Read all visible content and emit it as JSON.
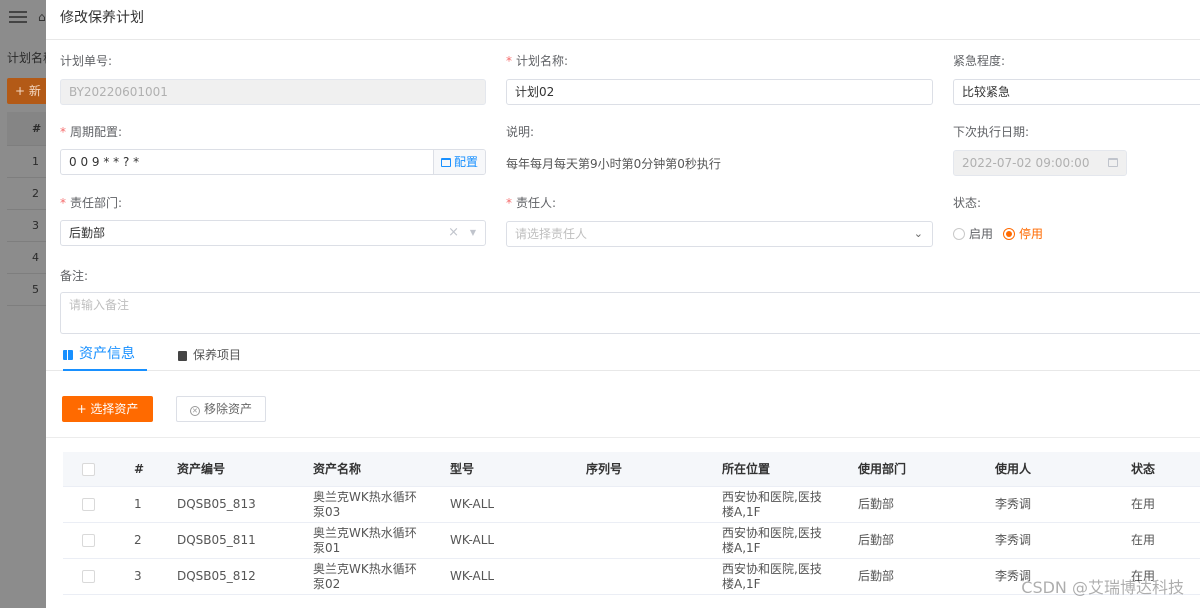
{
  "background": {
    "filter_label": "计划名称",
    "new_button_label": "+ 新",
    "table_head": "#",
    "row_numbers": [
      "1",
      "2",
      "3",
      "4",
      "5"
    ]
  },
  "modal": {
    "title": "修改保养计划",
    "form": {
      "plan_no": {
        "label": "计划单号:",
        "value": "BY20220601001"
      },
      "plan_name": {
        "label": "计划名称:",
        "value": "计划02"
      },
      "urgency": {
        "label": "紧急程度:",
        "value": "比较紧急"
      },
      "cycle": {
        "label": "周期配置:",
        "value": "0 0 9 * * ? *",
        "config_label": "配置"
      },
      "description": {
        "label": "说明:",
        "value": "每年每月每天第9小时第0分钟第0秒执行"
      },
      "next_date": {
        "label": "下次执行日期:",
        "value": "2022-07-02 09:00:00"
      },
      "department": {
        "label": "责任部门:",
        "value": "后勤部",
        "clear": "×"
      },
      "owner": {
        "label": "责任人:",
        "placeholder": "请选择责任人"
      },
      "status": {
        "label": "状态:",
        "options": [
          "启用",
          "停用"
        ],
        "selected": "停用"
      },
      "remark": {
        "label": "备注:",
        "placeholder": "请输入备注"
      }
    },
    "tabs": [
      {
        "label": "资产信息",
        "active": true
      },
      {
        "label": "保养项目",
        "active": false
      }
    ],
    "buttons": {
      "select_asset": "+ 选择资产",
      "remove_asset": "移除资产"
    },
    "table": {
      "columns": [
        "#",
        "资产编号",
        "资产名称",
        "型号",
        "序列号",
        "所在位置",
        "使用部门",
        "使用人",
        "状态"
      ],
      "rows": [
        {
          "no": "1",
          "code": "DQSB05_813",
          "name": "奥兰克WK热水循环泵03",
          "model": "WK-ALL",
          "serial": "",
          "location": "西安协和医院,医技楼A,1F",
          "dept": "后勤部",
          "user": "李秀调",
          "status": "在用"
        },
        {
          "no": "2",
          "code": "DQSB05_811",
          "name": "奥兰克WK热水循环泵01",
          "model": "WK-ALL",
          "serial": "",
          "location": "西安协和医院,医技楼A,1F",
          "dept": "后勤部",
          "user": "李秀调",
          "status": "在用"
        },
        {
          "no": "3",
          "code": "DQSB05_812",
          "name": "奥兰克WK热水循环泵02",
          "model": "WK-ALL",
          "serial": "",
          "location": "西安协和医院,医技楼A,1F",
          "dept": "后勤部",
          "user": "李秀调",
          "status": "在用"
        }
      ]
    }
  },
  "watermark": "CSDN @艾瑞博达科技",
  "colors": {
    "primary": "#ff6a00",
    "link": "#1890ff",
    "required": "#f56c6c"
  }
}
